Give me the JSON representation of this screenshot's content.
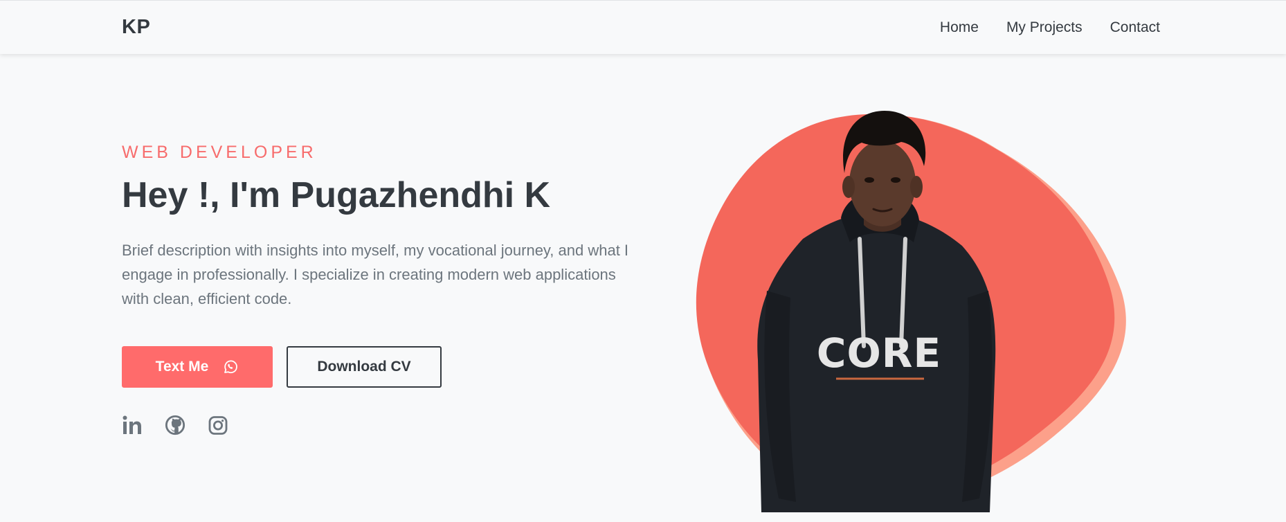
{
  "nav": {
    "brand": "KP",
    "links": [
      "Home",
      "My Projects",
      "Contact"
    ]
  },
  "hero": {
    "subtitle": "WEB DEVELOPER",
    "headline": "Hey !, I'm Pugazhendhi K",
    "description": "Brief description with insights into myself, my vocational journey, and what I engage in professionally. I specialize in creating modern web applications with clean, efficient code.",
    "primary_button": "Text Me",
    "secondary_button": "Download CV",
    "photo_shirt_text": "CORE"
  },
  "social_icons": [
    "linkedin-icon",
    "github-icon",
    "instagram-icon"
  ],
  "colors": {
    "accent": "#ff6b6b",
    "blob": "#f4675b",
    "blob_shadow": "#fca08a",
    "text_dark": "#343a40",
    "text_muted": "#6c757d",
    "background": "#f8f9fa"
  }
}
